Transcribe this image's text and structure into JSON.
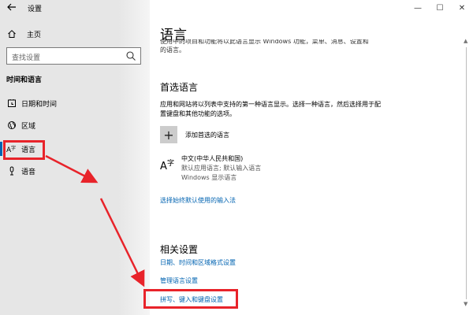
{
  "app_title": "设置",
  "window_controls": {
    "minimize": "—",
    "maximize": "☐",
    "close": "✕"
  },
  "sidebar": {
    "home_label": "主页",
    "search_placeholder": "查找设置",
    "section_title": "时间和语言",
    "items": [
      {
        "label": "日期和时间",
        "icon": "clock-icon"
      },
      {
        "label": "区域",
        "icon": "globe-icon"
      },
      {
        "label": "语言",
        "icon": "language-icon",
        "selected": true
      },
      {
        "label": "语音",
        "icon": "microphone-icon"
      }
    ]
  },
  "main": {
    "title": "语言",
    "clipped_line1": "使用中的项目和功能将以此语言显示 Windows 功能，菜单、消息、设置和帮助主题都将",
    "clipped_line2": "的语言。",
    "preferred": {
      "heading": "首选语言",
      "description": "应用和网站将以列表中支持的第一种语言显示。选择一种语言，然后选择用于配置键盘和其他功能的选项。",
      "add_label": "添加首选的语言",
      "language": {
        "name": "中文(中华人民共和国)",
        "sub1": "默认应用语言; 默认输入语言",
        "sub2": "Windows 显示语言"
      },
      "input_link": "选择始终默认使用的输入法"
    },
    "related": {
      "heading": "相关设置",
      "links": [
        "日期、时间和区域格式设置",
        "管理语言设置",
        "拼写、键入和键盘设置"
      ]
    }
  },
  "colors": {
    "accent": "#0063b1",
    "highlight": "#e8232a",
    "sidebar_bg": "#e6e6e6"
  }
}
